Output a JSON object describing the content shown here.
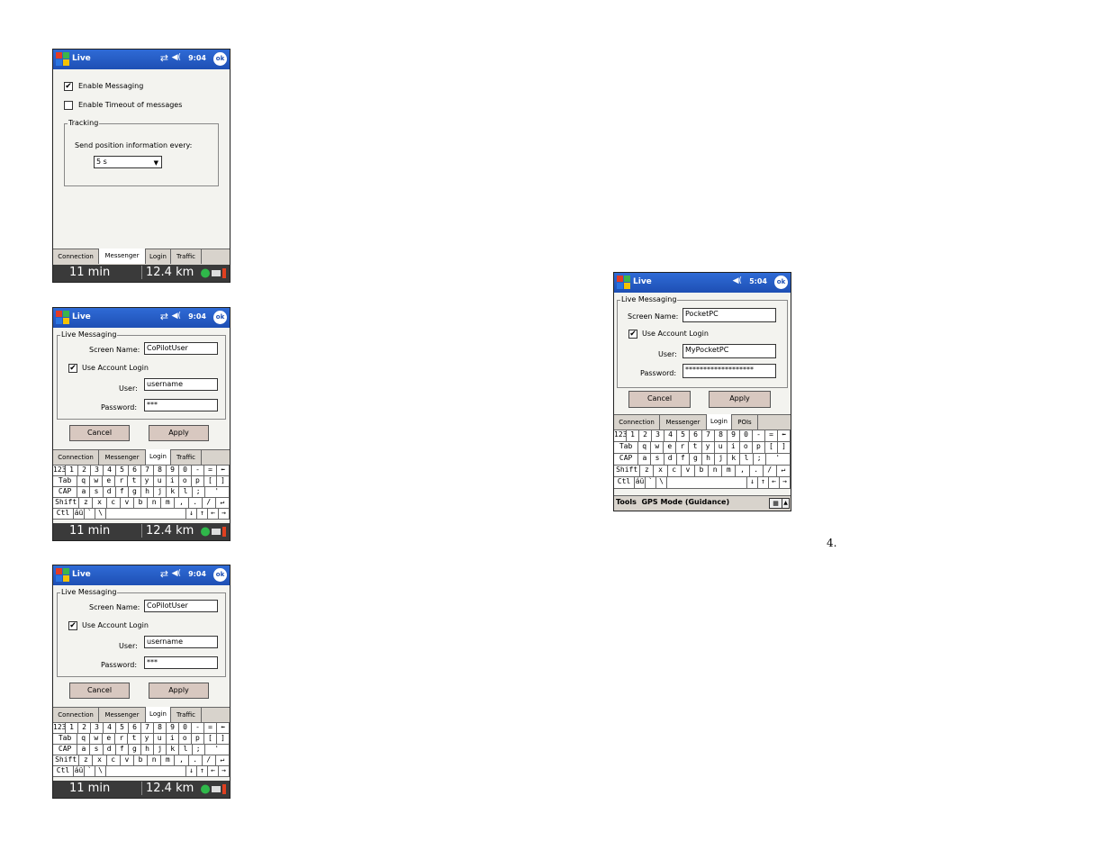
{
  "common": {
    "app_title": "Live",
    "ok_label": "ok",
    "status_time": "11 min",
    "status_distance": "12.4 km"
  },
  "screen1": {
    "clock": "9:04",
    "enable_messaging": "Enable Messaging",
    "enable_timeout": "Enable Timeout of messages",
    "tracking_group": "Tracking",
    "send_position": "Send position information every:",
    "interval_value": "5  s",
    "tabs": [
      "Connection",
      "Messenger",
      "Login",
      "Traffic"
    ]
  },
  "screen2": {
    "clock": "9:04",
    "group": "Live Messaging",
    "screen_name_label": "Screen Name:",
    "screen_name_value": "CoPilotUser",
    "use_account_login": "Use Account Login",
    "user_label": "User:",
    "user_value": "username",
    "password_label": "Password:",
    "password_value": "***",
    "cancel": "Cancel",
    "apply": "Apply",
    "tabs": [
      "Connection",
      "Messenger",
      "Login",
      "Traffic"
    ]
  },
  "screen3": {
    "clock": "9:04",
    "group": "Live Messaging",
    "screen_name_label": "Screen Name:",
    "screen_name_value": "CoPilotUser",
    "use_account_login": "Use Account Login",
    "user_label": "User:",
    "user_value": "username",
    "password_label": "Password:",
    "password_value": "***",
    "cancel": "Cancel",
    "apply": "Apply",
    "tabs": [
      "Connection",
      "Messenger",
      "Login",
      "Traffic"
    ]
  },
  "screen4": {
    "clock": "5:04",
    "group": "Live Messaging",
    "screen_name_label": "Screen Name:",
    "screen_name_value": "PocketPC",
    "use_account_login": "Use Account Login",
    "user_label": "User:",
    "user_value": "MyPocketPC",
    "password_label": "Password:",
    "password_value": "*******************",
    "cancel": "Cancel",
    "apply": "Apply",
    "tabs": [
      "Connection",
      "Messenger",
      "Login",
      "POIs"
    ],
    "menu": "Tools  GPS Mode (Guidance)"
  },
  "keyboard": {
    "row1": [
      "123",
      "1",
      "2",
      "3",
      "4",
      "5",
      "6",
      "7",
      "8",
      "9",
      "0",
      "-",
      "=",
      "⬅"
    ],
    "row2": [
      "Tab",
      "q",
      "w",
      "e",
      "r",
      "t",
      "y",
      "u",
      "i",
      "o",
      "p",
      "[",
      "]"
    ],
    "row3": [
      "CAP",
      "a",
      "s",
      "d",
      "f",
      "g",
      "h",
      "j",
      "k",
      "l",
      ";",
      "'"
    ],
    "row4": [
      "Shift",
      "z",
      "x",
      "c",
      "v",
      "b",
      "n",
      "m",
      ",",
      ".",
      "/",
      "↵"
    ],
    "row5": [
      "Ctl",
      "áü",
      "`",
      "\\",
      "",
      "↓",
      "↑",
      "←",
      "→"
    ]
  },
  "page_number": "4."
}
